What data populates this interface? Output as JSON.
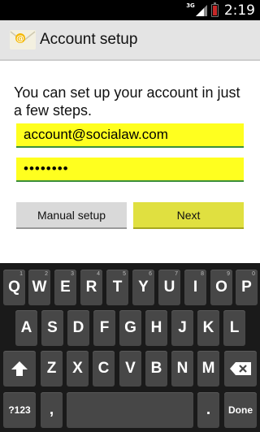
{
  "status_bar": {
    "network": "3G",
    "time": "2:19",
    "icons": [
      "signal-icon",
      "battery-icon"
    ]
  },
  "action_bar": {
    "icon": "email-envelope-icon",
    "title": "Account setup"
  },
  "main": {
    "intro_text": "You can set up your account in just a few steps.",
    "email_value": "account@socialaw.com",
    "password_mask": "••••••••",
    "manual_setup_label": "Manual setup",
    "next_label": "Next"
  },
  "keyboard": {
    "row1": [
      {
        "label": "Q",
        "hint": "1"
      },
      {
        "label": "W",
        "hint": "2"
      },
      {
        "label": "E",
        "hint": "3"
      },
      {
        "label": "R",
        "hint": "4"
      },
      {
        "label": "T",
        "hint": "5"
      },
      {
        "label": "Y",
        "hint": "6"
      },
      {
        "label": "U",
        "hint": "7"
      },
      {
        "label": "I",
        "hint": "8"
      },
      {
        "label": "O",
        "hint": "9"
      },
      {
        "label": "P",
        "hint": "0"
      }
    ],
    "row2": [
      "A",
      "S",
      "D",
      "F",
      "G",
      "H",
      "J",
      "K",
      "L"
    ],
    "row3": [
      "Z",
      "X",
      "C",
      "V",
      "B",
      "N",
      "M"
    ],
    "symbols_label": "?123",
    "comma_label": ",",
    "period_label": ".",
    "done_label": "Done",
    "accent": "#ffff1f"
  }
}
